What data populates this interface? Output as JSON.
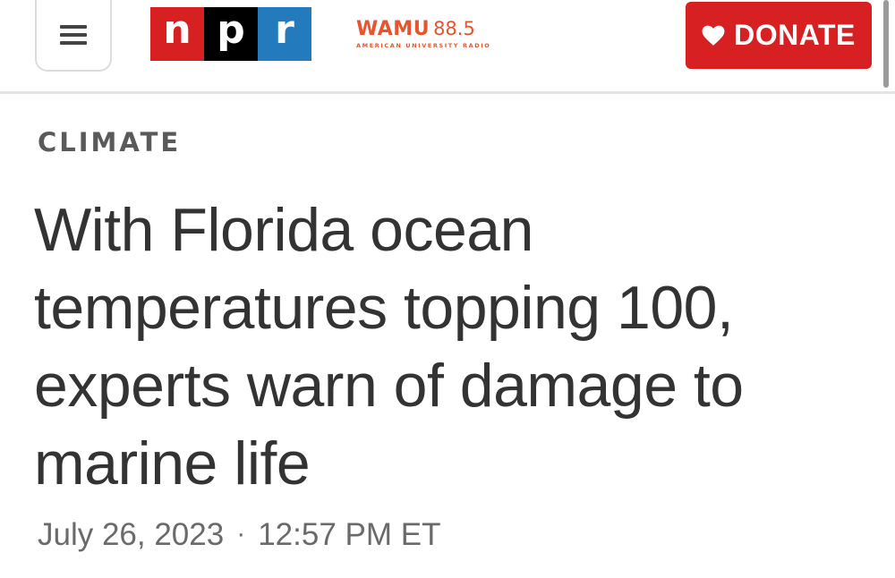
{
  "header": {
    "menu_icon": "hamburger-icon",
    "npr_logo": {
      "letters": [
        "n",
        "p",
        "r"
      ],
      "colors": [
        "#d62021",
        "#000000",
        "#237bbd"
      ]
    },
    "station_logo": {
      "name": "WAMU",
      "frequency": "88.5",
      "tagline": "AMERICAN UNIVERSITY RADIO",
      "color": "#e8542e"
    },
    "donate": {
      "label": "DONATE",
      "icon": "heart-icon",
      "color": "#d62021"
    }
  },
  "article": {
    "category": "CLIMATE",
    "headline": "With Florida ocean temperatures topping 100, experts warn of damage to marine life",
    "date": "July 26, 2023",
    "separator": "·",
    "time": "12:57 PM ET"
  }
}
